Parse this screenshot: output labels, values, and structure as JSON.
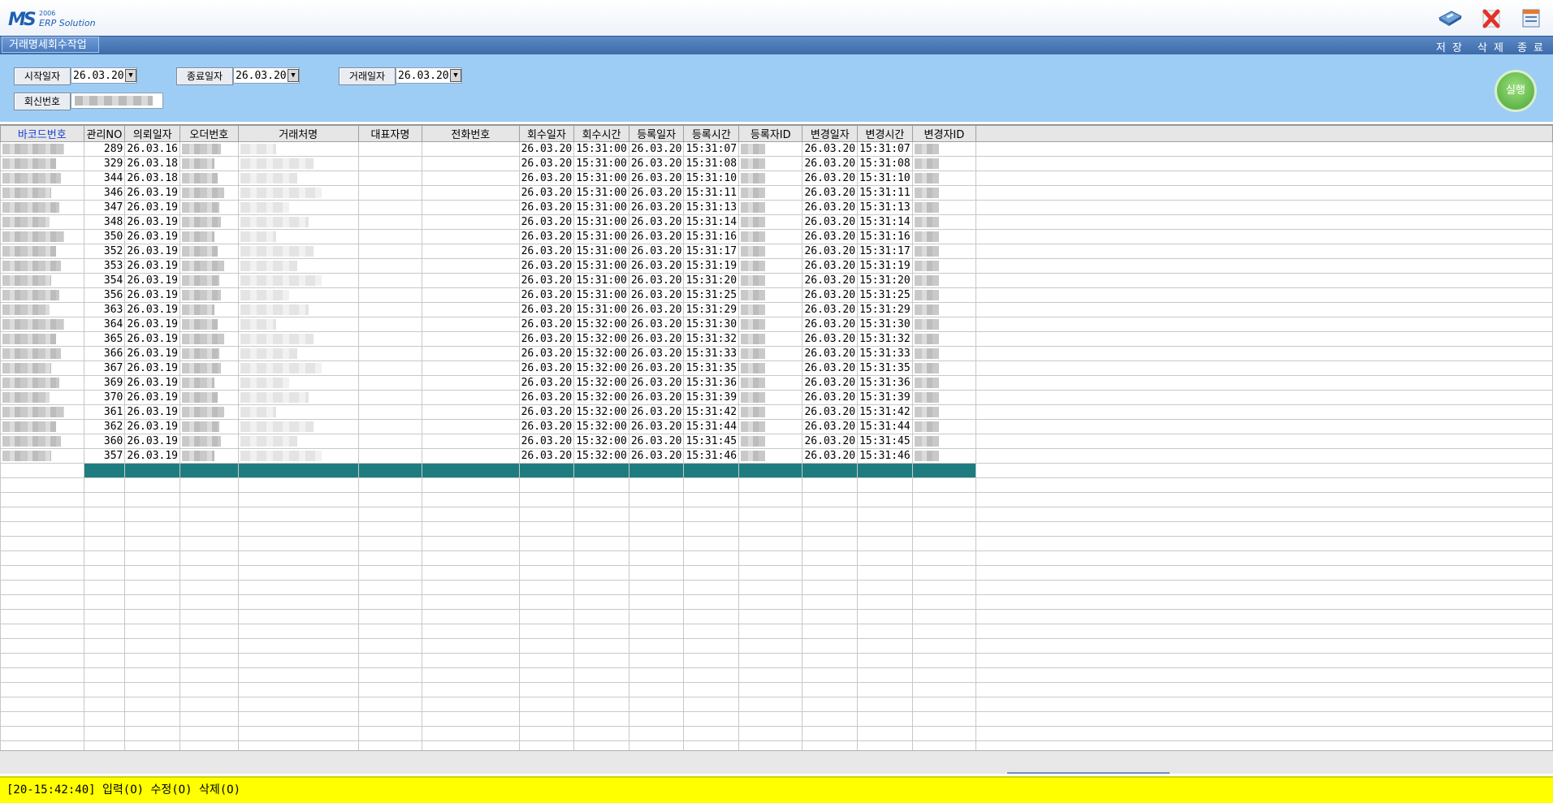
{
  "app": {
    "logo_mark": "MS",
    "logo_year": "2006",
    "logo_sub": "ERP Solution"
  },
  "toolbar": {
    "save_label": "저 장",
    "delete_label": "삭 제",
    "exit_label": "종 료"
  },
  "menu": {
    "active_tab": "거래명세회수작업"
  },
  "filters": {
    "start_date_label": "시작일자",
    "start_date_value": "26.03.20",
    "end_date_label": "종료일자",
    "end_date_value": "26.03.20",
    "trade_date_label": "거래일자",
    "trade_date_value": "26.03.20",
    "reply_no_label": "회신번호",
    "run_label": "실행"
  },
  "grid": {
    "columns": [
      "바코드번호",
      "관리NO",
      "의뢰일자",
      "오더번호",
      "거래처명",
      "대표자명",
      "전화번호",
      "회수일자",
      "회수시간",
      "등록일자",
      "등록시간",
      "등록자ID",
      "변경일자",
      "변경시간",
      "변경자ID"
    ],
    "rows": [
      {
        "no": "289",
        "req_date": "26.03.16",
        "ret_date": "26.03.20",
        "ret_time": "15:31:00",
        "reg_date": "26.03.20",
        "reg_time": "15:31:07",
        "chg_date": "26.03.20",
        "chg_time": "15:31:07"
      },
      {
        "no": "329",
        "req_date": "26.03.18",
        "ret_date": "26.03.20",
        "ret_time": "15:31:00",
        "reg_date": "26.03.20",
        "reg_time": "15:31:08",
        "chg_date": "26.03.20",
        "chg_time": "15:31:08"
      },
      {
        "no": "344",
        "req_date": "26.03.18",
        "ret_date": "26.03.20",
        "ret_time": "15:31:00",
        "reg_date": "26.03.20",
        "reg_time": "15:31:10",
        "chg_date": "26.03.20",
        "chg_time": "15:31:10"
      },
      {
        "no": "346",
        "req_date": "26.03.19",
        "ret_date": "26.03.20",
        "ret_time": "15:31:00",
        "reg_date": "26.03.20",
        "reg_time": "15:31:11",
        "chg_date": "26.03.20",
        "chg_time": "15:31:11"
      },
      {
        "no": "347",
        "req_date": "26.03.19",
        "ret_date": "26.03.20",
        "ret_time": "15:31:00",
        "reg_date": "26.03.20",
        "reg_time": "15:31:13",
        "chg_date": "26.03.20",
        "chg_time": "15:31:13"
      },
      {
        "no": "348",
        "req_date": "26.03.19",
        "ret_date": "26.03.20",
        "ret_time": "15:31:00",
        "reg_date": "26.03.20",
        "reg_time": "15:31:14",
        "chg_date": "26.03.20",
        "chg_time": "15:31:14"
      },
      {
        "no": "350",
        "req_date": "26.03.19",
        "ret_date": "26.03.20",
        "ret_time": "15:31:00",
        "reg_date": "26.03.20",
        "reg_time": "15:31:16",
        "chg_date": "26.03.20",
        "chg_time": "15:31:16"
      },
      {
        "no": "352",
        "req_date": "26.03.19",
        "ret_date": "26.03.20",
        "ret_time": "15:31:00",
        "reg_date": "26.03.20",
        "reg_time": "15:31:17",
        "chg_date": "26.03.20",
        "chg_time": "15:31:17"
      },
      {
        "no": "353",
        "req_date": "26.03.19",
        "ret_date": "26.03.20",
        "ret_time": "15:31:00",
        "reg_date": "26.03.20",
        "reg_time": "15:31:19",
        "chg_date": "26.03.20",
        "chg_time": "15:31:19"
      },
      {
        "no": "354",
        "req_date": "26.03.19",
        "ret_date": "26.03.20",
        "ret_time": "15:31:00",
        "reg_date": "26.03.20",
        "reg_time": "15:31:20",
        "chg_date": "26.03.20",
        "chg_time": "15:31:20"
      },
      {
        "no": "356",
        "req_date": "26.03.19",
        "ret_date": "26.03.20",
        "ret_time": "15:31:00",
        "reg_date": "26.03.20",
        "reg_time": "15:31:25",
        "chg_date": "26.03.20",
        "chg_time": "15:31:25"
      },
      {
        "no": "363",
        "req_date": "26.03.19",
        "ret_date": "26.03.20",
        "ret_time": "15:31:00",
        "reg_date": "26.03.20",
        "reg_time": "15:31:29",
        "chg_date": "26.03.20",
        "chg_time": "15:31:29"
      },
      {
        "no": "364",
        "req_date": "26.03.19",
        "ret_date": "26.03.20",
        "ret_time": "15:32:00",
        "reg_date": "26.03.20",
        "reg_time": "15:31:30",
        "chg_date": "26.03.20",
        "chg_time": "15:31:30"
      },
      {
        "no": "365",
        "req_date": "26.03.19",
        "ret_date": "26.03.20",
        "ret_time": "15:32:00",
        "reg_date": "26.03.20",
        "reg_time": "15:31:32",
        "chg_date": "26.03.20",
        "chg_time": "15:31:32"
      },
      {
        "no": "366",
        "req_date": "26.03.19",
        "ret_date": "26.03.20",
        "ret_time": "15:32:00",
        "reg_date": "26.03.20",
        "reg_time": "15:31:33",
        "chg_date": "26.03.20",
        "chg_time": "15:31:33"
      },
      {
        "no": "367",
        "req_date": "26.03.19",
        "ret_date": "26.03.20",
        "ret_time": "15:32:00",
        "reg_date": "26.03.20",
        "reg_time": "15:31:35",
        "chg_date": "26.03.20",
        "chg_time": "15:31:35"
      },
      {
        "no": "369",
        "req_date": "26.03.19",
        "ret_date": "26.03.20",
        "ret_time": "15:32:00",
        "reg_date": "26.03.20",
        "reg_time": "15:31:36",
        "chg_date": "26.03.20",
        "chg_time": "15:31:36"
      },
      {
        "no": "370",
        "req_date": "26.03.19",
        "ret_date": "26.03.20",
        "ret_time": "15:32:00",
        "reg_date": "26.03.20",
        "reg_time": "15:31:39",
        "chg_date": "26.03.20",
        "chg_time": "15:31:39"
      },
      {
        "no": "361",
        "req_date": "26.03.19",
        "ret_date": "26.03.20",
        "ret_time": "15:32:00",
        "reg_date": "26.03.20",
        "reg_time": "15:31:42",
        "chg_date": "26.03.20",
        "chg_time": "15:31:42"
      },
      {
        "no": "362",
        "req_date": "26.03.19",
        "ret_date": "26.03.20",
        "ret_time": "15:32:00",
        "reg_date": "26.03.20",
        "reg_time": "15:31:44",
        "chg_date": "26.03.20",
        "chg_time": "15:31:44"
      },
      {
        "no": "360",
        "req_date": "26.03.19",
        "ret_date": "26.03.20",
        "ret_time": "15:32:00",
        "reg_date": "26.03.20",
        "reg_time": "15:31:45",
        "chg_date": "26.03.20",
        "chg_time": "15:31:45"
      },
      {
        "no": "357",
        "req_date": "26.03.19",
        "ret_date": "26.03.20",
        "ret_time": "15:32:00",
        "reg_date": "26.03.20",
        "reg_time": "15:31:46",
        "chg_date": "26.03.20",
        "chg_time": "15:31:46"
      }
    ]
  },
  "status": {
    "message": "[20-15:42:40] 입력(O) 수정(O) 삭제(O)"
  },
  "colors": {
    "filter_panel": "#9dcdf5",
    "selected_row": "#1e7c80",
    "status_bar": "#ffff00",
    "menu_bar": "#3c6aa8"
  }
}
